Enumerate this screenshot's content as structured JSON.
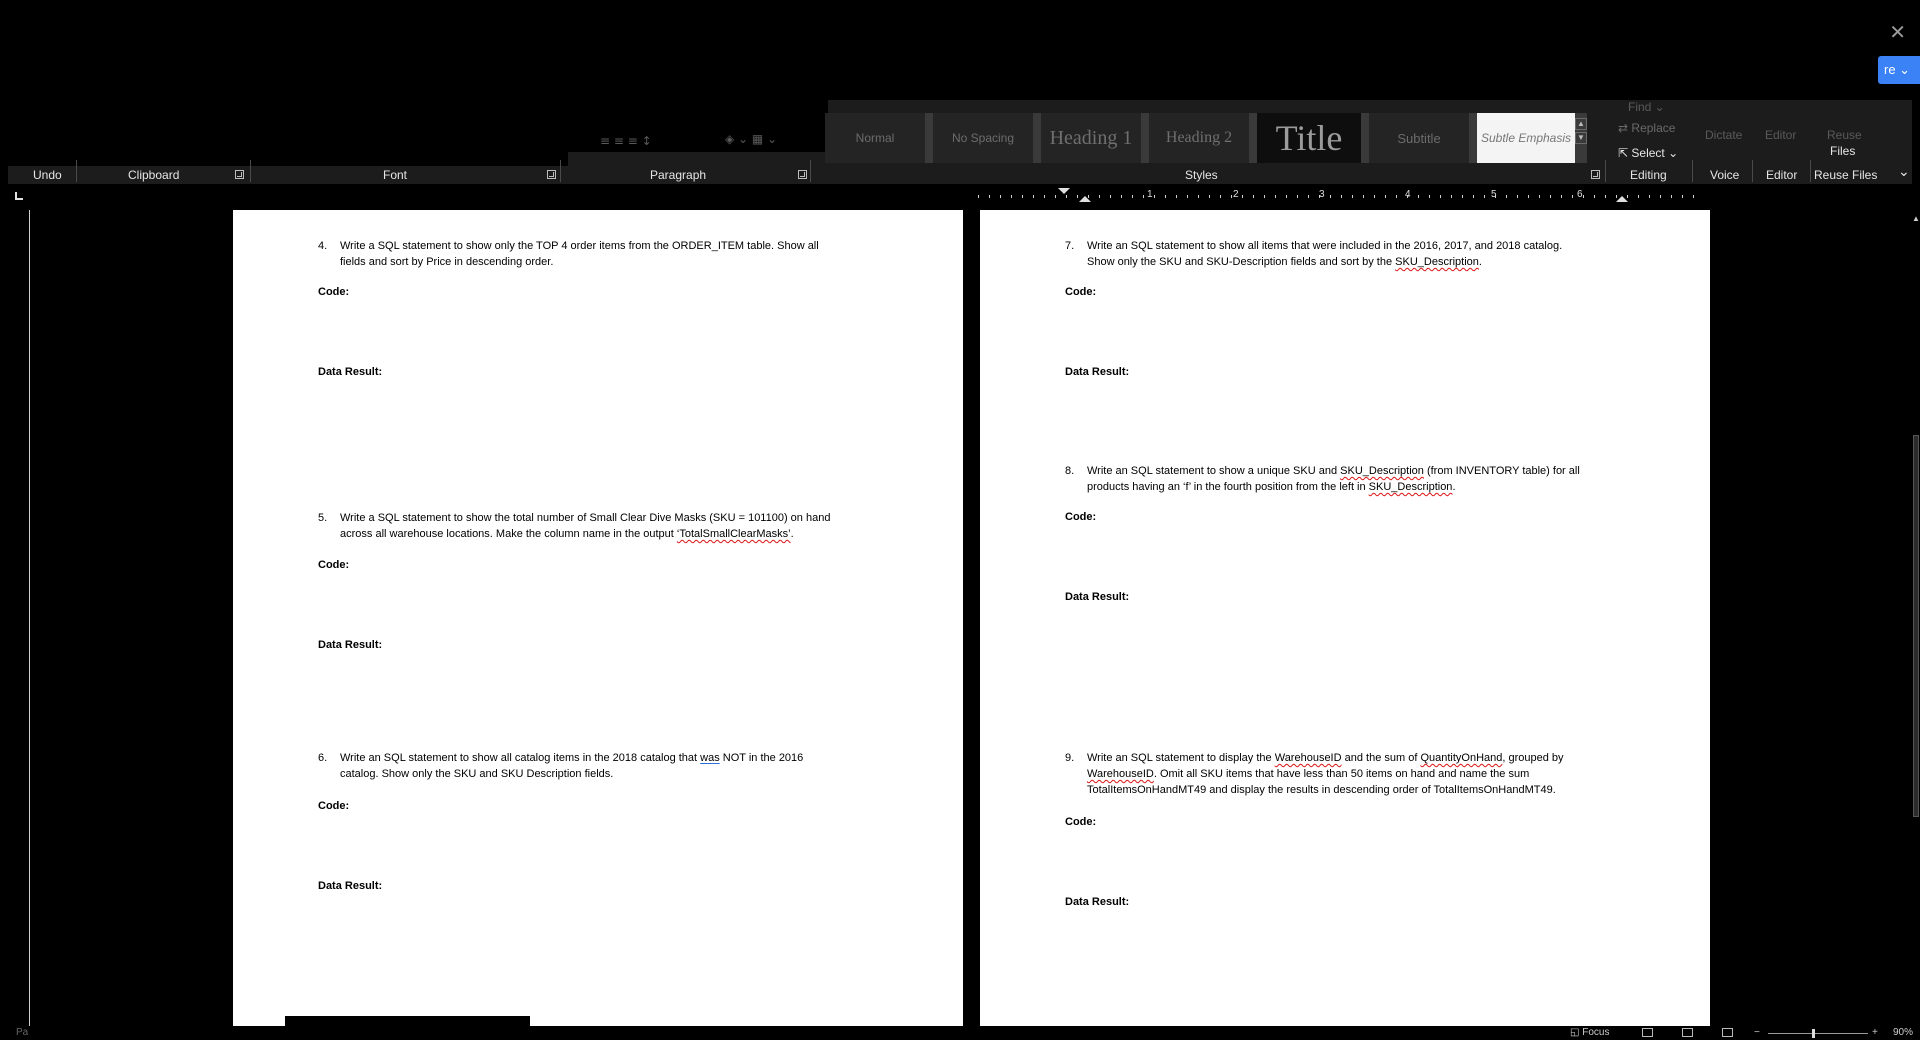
{
  "window": {
    "close_glyph": "✕",
    "share_label": "re ⌄"
  },
  "ribbon": {
    "groups": {
      "undo": "Undo",
      "clipboard": "Clipboard",
      "font": "Font",
      "paragraph": "Paragraph",
      "styles": "Styles",
      "editing": "Editing",
      "voice": "Voice",
      "editor": "Editor",
      "reuse_files": "Reuse Files"
    },
    "styles_gallery": {
      "normal": "Normal",
      "no_spacing": "No Spacing",
      "heading1": "Heading 1",
      "heading2": "Heading 2",
      "title": "Title",
      "subtitle": "Subtitle",
      "subtle_emphasis": "Subtle Emphasis"
    },
    "editing": {
      "find": "Find ⌄",
      "replace": "Replace",
      "select": "Select ⌄"
    },
    "voice_btn": "Dictate",
    "editor_btn": "Editor",
    "reuse_btn_top": "Reuse",
    "reuse_btn_bottom": "Files",
    "collapse_glyph": "⌄"
  },
  "ruler": {
    "numbers": [
      "1",
      "2",
      "3",
      "4",
      "5",
      "6"
    ]
  },
  "page_left": {
    "q4": {
      "num": "4.",
      "line1": "Write a SQL statement to show only the TOP 4 order items from the ORDER_ITEM table.  Show all",
      "line2": "fields and sort by Price in descending order."
    },
    "q4_code": "Code:",
    "q4_result": "Data Result:",
    "q5": {
      "num": "5.",
      "line1": "Write a SQL statement to show the total number of Small Clear Dive Masks (SKU = 101100) on hand",
      "line2_a": "across all warehouse locations. Make the column name in the output ",
      "line2_b": "‘TotalSmallClearMasks’",
      "line2_c": "."
    },
    "q5_code": "Code:",
    "q5_result": "Data Result:",
    "q6": {
      "num": "6.",
      "line1_a": "Write an SQL statement to show all catalog items in the 2018 catalog that ",
      "line1_b": "was",
      "line1_c": " NOT in the 2016",
      "line2": "catalog.  Show only the SKU and SKU Description fields."
    },
    "q6_code": "Code:",
    "q6_result": "Data Result:"
  },
  "page_right": {
    "q7": {
      "num": "7.",
      "line1": "Write an SQL statement to show all items that were included in the 2016, 2017, and 2018 catalog.",
      "line2_a": "Show only the SKU and SKU-Description fields and sort by the ",
      "line2_b": "SKU_Description",
      "line2_c": "."
    },
    "q7_code": "Code:",
    "q7_result": "Data Result:",
    "q8": {
      "num": "8.",
      "line1_a": "Write an SQL statement to show a unique SKU and ",
      "line1_b": "SKU_Description",
      "line1_c": " (from INVENTORY table) for all",
      "line2_a": "products having an ‘f’ in the fourth position from the left in ",
      "line2_b": "SKU_Description",
      "line2_c": "."
    },
    "q8_code": "Code:",
    "q8_result": "Data Result:",
    "q9": {
      "num": "9.",
      "line1_a": "Write an SQL statement to display the ",
      "line1_b": "WarehouseID",
      "line1_c": " and the sum of ",
      "line1_d": "QuantityOnHand",
      "line1_e": ", grouped by",
      "line2_a": "WarehouseID",
      "line2_b": ". Omit all SKU items that have less than 50 items on hand and name the sum",
      "line3": "TotalItemsOnHandMT49 and display the results in descending order of TotalItemsOnHandMT49."
    },
    "q9_code": "Code:",
    "q9_result": "Data Result:"
  },
  "statusbar": {
    "page_info": "Pa",
    "focus": "Focus",
    "zoom_minus": "−",
    "zoom_plus": "+",
    "zoom": "90%"
  }
}
